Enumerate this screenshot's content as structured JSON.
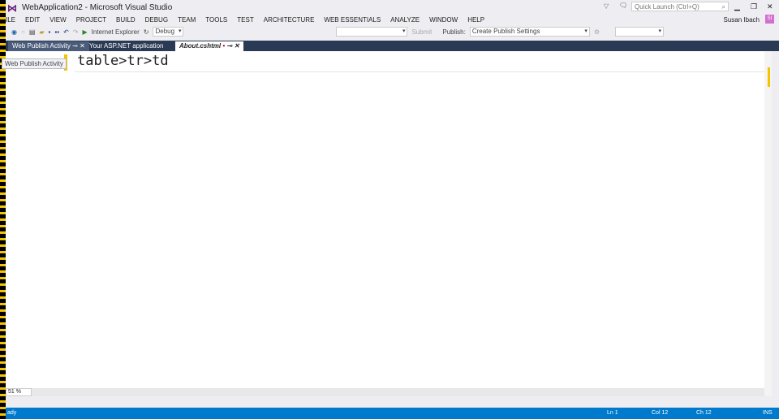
{
  "window": {
    "title": "WebApplication2 - Microsoft Visual Studio",
    "quick_launch_placeholder": "Quick Launch (Ctrl+Q)",
    "user": "Susan Ibach",
    "avatar": "SI"
  },
  "menu": [
    "ILE",
    "EDIT",
    "VIEW",
    "PROJECT",
    "BUILD",
    "DEBUG",
    "TEAM",
    "TOOLS",
    "TEST",
    "ARCHITECTURE",
    "WEB ESSENTIALS",
    "ANALYZE",
    "WINDOW",
    "HELP"
  ],
  "toolbar": {
    "browser": "Internet Explorer",
    "config": "Debug",
    "submit": "Submit",
    "publish_label": "Publish:",
    "publish_value": "Create Publish Settings"
  },
  "tabs": [
    {
      "label": "Web Publish Activity"
    },
    {
      "label": "Your ASP.NET application"
    },
    {
      "label": "About.cshtml"
    }
  ],
  "tooltip": "Web Publish Activity",
  "editor": {
    "code": "table>tr>td",
    "zoom": "51 %"
  },
  "status": {
    "text": "ady",
    "ln": "Ln 1",
    "col": "Col 12",
    "ch": "Ch 12",
    "mode": "INS"
  }
}
